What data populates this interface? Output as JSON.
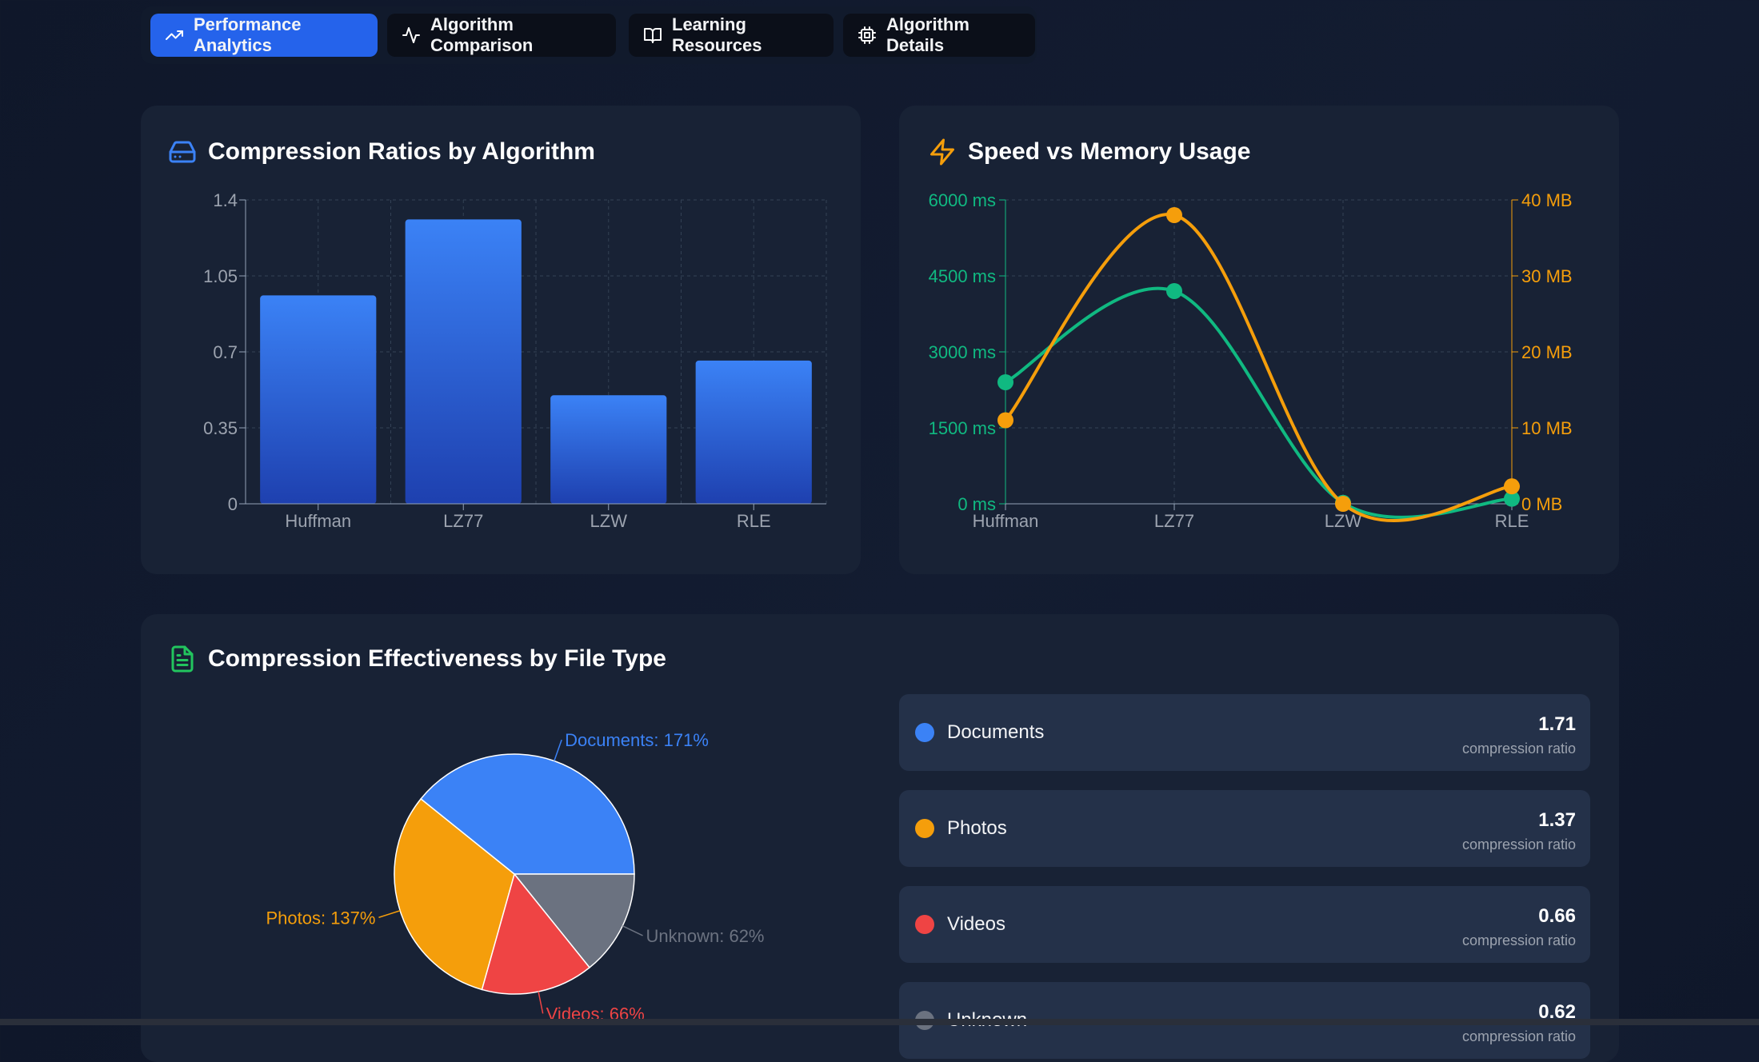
{
  "tabs": [
    {
      "label": "Performance Analytics",
      "icon": "trending-up-icon",
      "active": true
    },
    {
      "label": "Algorithm Comparison",
      "icon": "activity-icon",
      "active": false
    },
    {
      "label": "Learning Resources",
      "icon": "book-open-icon",
      "active": false
    },
    {
      "label": "Algorithm Details",
      "icon": "cpu-icon",
      "active": false
    }
  ],
  "colors": {
    "accent": "#2563eb",
    "bar_top": "#3b82f6",
    "bar_bottom": "#1e40af",
    "speed": "#10b981",
    "memory": "#f59e0b",
    "documents": "#3b82f6",
    "photos": "#f59e0b",
    "videos": "#ef4444",
    "unknown": "#6b7280"
  },
  "ratios_card": {
    "title": "Compression Ratios by Algorithm",
    "icon": "hard-drive-icon"
  },
  "speed_card": {
    "title": "Speed vs Memory Usage",
    "icon": "zap-icon"
  },
  "filetype_card": {
    "title": "Compression Effectiveness by File Type",
    "icon": "file-text-icon",
    "legend": [
      {
        "name": "Documents",
        "value": "1.71",
        "unit": "compression ratio",
        "color": "#3b82f6"
      },
      {
        "name": "Photos",
        "value": "1.37",
        "unit": "compression ratio",
        "color": "#f59e0b"
      },
      {
        "name": "Videos",
        "value": "0.66",
        "unit": "compression ratio",
        "color": "#ef4444"
      },
      {
        "name": "Unknown",
        "value": "0.62",
        "unit": "compression ratio",
        "color": "#6b7280"
      }
    ]
  },
  "chart_data": [
    {
      "type": "bar",
      "categories": [
        "Huffman",
        "LZ77",
        "LZW",
        "RLE"
      ],
      "values": [
        0.96,
        1.31,
        0.5,
        0.66
      ],
      "ylim": [
        0,
        1.4
      ],
      "yticks": [
        "0",
        "0.35",
        "0.7",
        "1.05",
        "1.4"
      ],
      "grid": true
    },
    {
      "type": "line",
      "categories": [
        "Huffman",
        "LZ77",
        "LZW",
        "RLE"
      ],
      "series": [
        {
          "name": "",
          "axis": "left",
          "values": [
            2400,
            4200,
            20,
            100
          ]
        },
        {
          "name": "",
          "axis": "right",
          "values": [
            11,
            38,
            0,
            2.3
          ]
        }
      ],
      "left_ylim": [
        0,
        6000
      ],
      "right_ylim": [
        0,
        40
      ],
      "left_yticks": [
        "0 ms",
        "1500 ms",
        "3000 ms",
        "4500 ms",
        "6000 ms"
      ],
      "right_yticks": [
        "0 MB",
        "10 MB",
        "20 MB",
        "30 MB",
        "40 MB"
      ],
      "grid": true
    },
    {
      "type": "pie",
      "slices": [
        {
          "label": "Documents: 171%",
          "value": 171
        },
        {
          "label": "Unknown: 62%",
          "value": 62
        },
        {
          "label": "Videos: 66%",
          "value": 66
        },
        {
          "label": "Photos: 137%",
          "value": 137
        }
      ]
    }
  ]
}
